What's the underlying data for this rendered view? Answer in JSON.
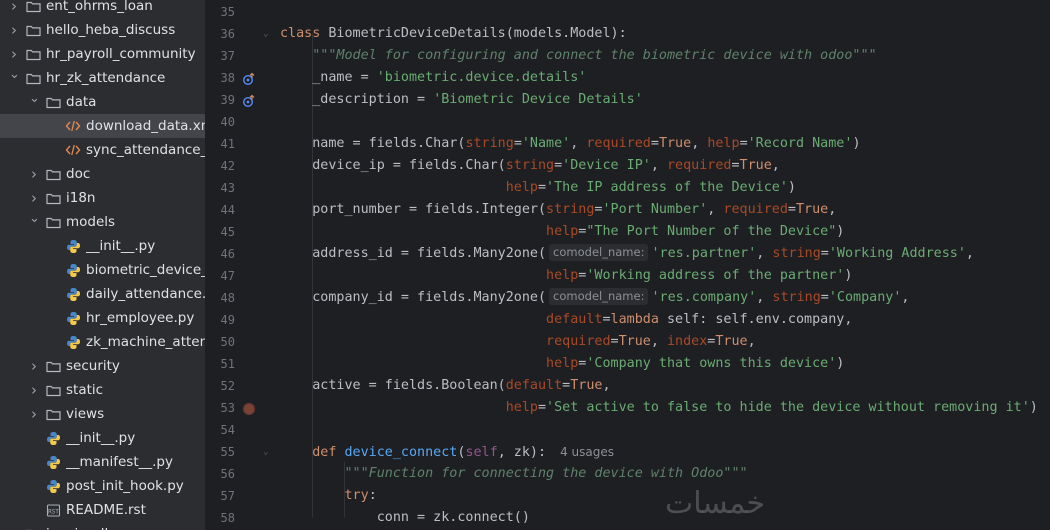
{
  "tree": {
    "items": [
      {
        "label": "ent_ohrms_loan",
        "type": "folder",
        "expanded": false,
        "depth": 1
      },
      {
        "label": "hello_heba_discuss",
        "type": "folder",
        "expanded": false,
        "depth": 1
      },
      {
        "label": "hr_payroll_community",
        "type": "folder",
        "expanded": false,
        "depth": 1
      },
      {
        "label": "hr_zk_attendance",
        "type": "folder",
        "expanded": true,
        "depth": 1
      },
      {
        "label": "data",
        "type": "folder",
        "expanded": true,
        "depth": 2
      },
      {
        "label": "download_data.xml",
        "type": "xml",
        "depth": 3,
        "selected": true
      },
      {
        "label": "sync_attendance_c",
        "type": "xml",
        "depth": 3
      },
      {
        "label": "doc",
        "type": "folder",
        "expanded": false,
        "depth": 2
      },
      {
        "label": "i18n",
        "type": "folder",
        "expanded": false,
        "depth": 2
      },
      {
        "label": "models",
        "type": "folder",
        "expanded": true,
        "depth": 2
      },
      {
        "label": "__init__.py",
        "type": "python",
        "depth": 3
      },
      {
        "label": "biometric_device_d",
        "type": "python",
        "depth": 3
      },
      {
        "label": "daily_attendance.py",
        "type": "python",
        "depth": 3
      },
      {
        "label": "hr_employee.py",
        "type": "python",
        "depth": 3
      },
      {
        "label": "zk_machine_attend",
        "type": "python",
        "depth": 3
      },
      {
        "label": "security",
        "type": "folder",
        "expanded": false,
        "depth": 2
      },
      {
        "label": "static",
        "type": "folder",
        "expanded": false,
        "depth": 2
      },
      {
        "label": "views",
        "type": "folder",
        "expanded": false,
        "depth": 2
      },
      {
        "label": "__init__.py",
        "type": "python",
        "depth": 2
      },
      {
        "label": "__manifest__.py",
        "type": "python",
        "depth": 2
      },
      {
        "label": "post_init_hook.py",
        "type": "python",
        "depth": 2
      },
      {
        "label": "README.rst",
        "type": "rst",
        "depth": 2
      },
      {
        "label": "invoice_ll...",
        "type": "folder",
        "expanded": false,
        "depth": 1
      }
    ]
  },
  "editor": {
    "line_numbers": [
      "35",
      "36",
      "37",
      "38",
      "39",
      "40",
      "41",
      "42",
      "43",
      "44",
      "45",
      "46",
      "47",
      "48",
      "49",
      "50",
      "51",
      "52",
      "53",
      "54",
      "55",
      "56",
      "57",
      "58"
    ],
    "lines": [
      [],
      [
        {
          "c": "kw",
          "t": "class "
        },
        {
          "c": "cls",
          "t": "BiometricDeviceDetails(models.Model):"
        }
      ],
      [
        {
          "c": "",
          "t": "    "
        },
        {
          "c": "doc",
          "t": "\"\"\"Model for configuring and connect the biometric device with odoo\"\"\""
        }
      ],
      [
        {
          "c": "",
          "t": "    _name = "
        },
        {
          "c": "str",
          "t": "'biometric.device.details'"
        }
      ],
      [
        {
          "c": "",
          "t": "    _description = "
        },
        {
          "c": "str",
          "t": "'Biometric Device Details'"
        }
      ],
      [],
      [
        {
          "c": "",
          "t": "    name = fields.Char("
        },
        {
          "c": "param",
          "t": "string"
        },
        {
          "c": "",
          "t": "="
        },
        {
          "c": "str",
          "t": "'Name'"
        },
        {
          "c": "",
          "t": ", "
        },
        {
          "c": "param",
          "t": "required"
        },
        {
          "c": "",
          "t": "="
        },
        {
          "c": "kw",
          "t": "True"
        },
        {
          "c": "",
          "t": ", "
        },
        {
          "c": "param",
          "t": "help"
        },
        {
          "c": "",
          "t": "="
        },
        {
          "c": "str",
          "t": "'Record Name'"
        },
        {
          "c": "",
          "t": ")"
        }
      ],
      [
        {
          "c": "",
          "t": "    device_ip = fields.Char("
        },
        {
          "c": "param",
          "t": "string"
        },
        {
          "c": "",
          "t": "="
        },
        {
          "c": "str",
          "t": "'Device IP'"
        },
        {
          "c": "",
          "t": ", "
        },
        {
          "c": "param",
          "t": "required"
        },
        {
          "c": "",
          "t": "="
        },
        {
          "c": "kw",
          "t": "True"
        },
        {
          "c": "",
          "t": ","
        }
      ],
      [
        {
          "c": "",
          "t": "                            "
        },
        {
          "c": "param",
          "t": "help"
        },
        {
          "c": "",
          "t": "="
        },
        {
          "c": "str",
          "t": "'The IP address of the Device'"
        },
        {
          "c": "",
          "t": ")"
        }
      ],
      [
        {
          "c": "",
          "t": "    port_number = fields.Integer("
        },
        {
          "c": "param",
          "t": "string"
        },
        {
          "c": "",
          "t": "="
        },
        {
          "c": "str",
          "t": "'Port Number'"
        },
        {
          "c": "",
          "t": ", "
        },
        {
          "c": "param",
          "t": "required"
        },
        {
          "c": "",
          "t": "="
        },
        {
          "c": "kw",
          "t": "True"
        },
        {
          "c": "",
          "t": ","
        }
      ],
      [
        {
          "c": "",
          "t": "                                 "
        },
        {
          "c": "param",
          "t": "help"
        },
        {
          "c": "",
          "t": "="
        },
        {
          "c": "str",
          "t": "\"The Port Number of the Device\""
        },
        {
          "c": "",
          "t": ")"
        }
      ],
      [
        {
          "c": "",
          "t": "    address_id = fields.Many2one("
        },
        {
          "c": "hint",
          "t": "comodel_name:"
        },
        {
          "c": "str",
          "t": "'res.partner'"
        },
        {
          "c": "",
          "t": ", "
        },
        {
          "c": "param",
          "t": "string"
        },
        {
          "c": "",
          "t": "="
        },
        {
          "c": "str",
          "t": "'Working Address'"
        },
        {
          "c": "",
          "t": ","
        }
      ],
      [
        {
          "c": "",
          "t": "                                 "
        },
        {
          "c": "param",
          "t": "help"
        },
        {
          "c": "",
          "t": "="
        },
        {
          "c": "str",
          "t": "'Working address of the partner'"
        },
        {
          "c": "",
          "t": ")"
        }
      ],
      [
        {
          "c": "",
          "t": "    company_id = fields.Many2one("
        },
        {
          "c": "hint",
          "t": "comodel_name:"
        },
        {
          "c": "str",
          "t": "'res.company'"
        },
        {
          "c": "",
          "t": ", "
        },
        {
          "c": "param",
          "t": "string"
        },
        {
          "c": "",
          "t": "="
        },
        {
          "c": "str",
          "t": "'Company'"
        },
        {
          "c": "",
          "t": ","
        }
      ],
      [
        {
          "c": "",
          "t": "                                 "
        },
        {
          "c": "param",
          "t": "default"
        },
        {
          "c": "",
          "t": "="
        },
        {
          "c": "kw",
          "t": "lambda "
        },
        {
          "c": "",
          "t": "self: self.env.company,"
        }
      ],
      [
        {
          "c": "",
          "t": "                                 "
        },
        {
          "c": "param",
          "t": "required"
        },
        {
          "c": "",
          "t": "="
        },
        {
          "c": "kw",
          "t": "True"
        },
        {
          "c": "",
          "t": ", "
        },
        {
          "c": "param",
          "t": "index"
        },
        {
          "c": "",
          "t": "="
        },
        {
          "c": "kw",
          "t": "True"
        },
        {
          "c": "",
          "t": ","
        }
      ],
      [
        {
          "c": "",
          "t": "                                 "
        },
        {
          "c": "param",
          "t": "help"
        },
        {
          "c": "",
          "t": "="
        },
        {
          "c": "str",
          "t": "'Company that owns this device'"
        },
        {
          "c": "",
          "t": ")"
        }
      ],
      [
        {
          "c": "",
          "t": "    active = fields.Boolean("
        },
        {
          "c": "param",
          "t": "default"
        },
        {
          "c": "",
          "t": "="
        },
        {
          "c": "kw",
          "t": "True"
        },
        {
          "c": "",
          "t": ","
        }
      ],
      [
        {
          "c": "",
          "t": "                            "
        },
        {
          "c": "param",
          "t": "help"
        },
        {
          "c": "",
          "t": "="
        },
        {
          "c": "str",
          "t": "'Set active to false to hide the device without removing it'"
        },
        {
          "c": "",
          "t": ")"
        }
      ],
      [],
      [
        {
          "c": "",
          "t": "    "
        },
        {
          "c": "kw",
          "t": "def "
        },
        {
          "c": "fn",
          "t": "device_connect"
        },
        {
          "c": "",
          "t": "("
        },
        {
          "c": "self",
          "t": "self"
        },
        {
          "c": "",
          "t": ", zk):"
        },
        {
          "c": "usages",
          "t": "4 usages"
        }
      ],
      [
        {
          "c": "",
          "t": "        "
        },
        {
          "c": "doc",
          "t": "\"\"\"Function for connecting the device with Odoo\"\"\""
        }
      ],
      [
        {
          "c": "",
          "t": "        "
        },
        {
          "c": "kw",
          "t": "try"
        },
        {
          "c": "",
          "t": ":"
        }
      ],
      [
        {
          "c": "",
          "t": "            conn = zk.connect()"
        }
      ]
    ]
  },
  "watermark": "خمسات",
  "colors": {
    "tree_bg": "#2b2d30",
    "editor_bg": "#1e1f22",
    "keyword": "#cf8e6d",
    "string": "#6aab73",
    "docstring": "#5f826b",
    "param": "#aa4926",
    "function": "#56a8f5",
    "self": "#94558d"
  }
}
